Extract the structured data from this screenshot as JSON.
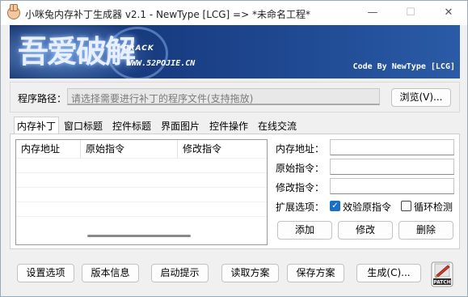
{
  "window": {
    "title": "小咪兔内存补丁生成器 v2.1  -  NewType [LCG]   =>   *未命名工程*",
    "minimize": "—",
    "maximize": "☐",
    "close": "✕"
  },
  "banner": {
    "logo_text": "吾爱破解",
    "logo_sub": "CRACK",
    "url": "WWW.52POJIE.CN",
    "credit": "Code By NewType [LCG]"
  },
  "path": {
    "label": "程序路径：",
    "placeholder": "请选择需要进行补丁的程序文件(支持拖放)",
    "browse_label": "浏览(V)..."
  },
  "tabs": [
    {
      "label": "内存补丁",
      "active": true
    },
    {
      "label": "窗口标题"
    },
    {
      "label": "控件标题"
    },
    {
      "label": "界面图片"
    },
    {
      "label": "控件操作"
    },
    {
      "label": "在线交流"
    }
  ],
  "table": {
    "columns": [
      "内存地址",
      "原始指令",
      "修改指令"
    ]
  },
  "form": {
    "address_label": "内存地址：",
    "original_label": "原始指令：",
    "modified_label": "修改指令：",
    "options_label": "扩展选项：",
    "verify_label": "效验原指令",
    "verify_checked": true,
    "loop_label": "循环检测",
    "loop_checked": false,
    "add_label": "添加",
    "modify_label": "修改",
    "delete_label": "删除"
  },
  "bottom": {
    "settings_label": "设置选项",
    "version_label": "版本信息",
    "startup_label": "启动提示",
    "load_label": "读取方案",
    "save_label": "保存方案",
    "generate_label": "生成(C)...",
    "patch_icon_text": "PATCH"
  }
}
